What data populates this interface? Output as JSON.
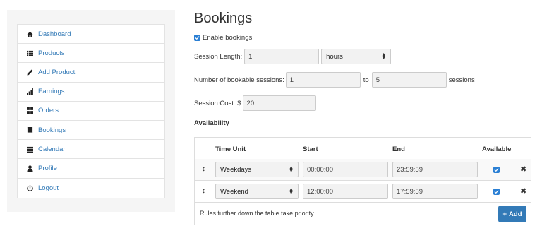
{
  "sidebar": {
    "items": [
      {
        "label": "Dashboard",
        "icon": "home-icon"
      },
      {
        "label": "Products",
        "icon": "list-icon"
      },
      {
        "label": "Add Product",
        "icon": "pencil-icon"
      },
      {
        "label": "Earnings",
        "icon": "signal-icon"
      },
      {
        "label": "Orders",
        "icon": "grid-icon"
      },
      {
        "label": "Bookings",
        "icon": "book-icon"
      },
      {
        "label": "Calendar",
        "icon": "calendar-icon"
      },
      {
        "label": "Profile",
        "icon": "user-icon"
      },
      {
        "label": "Logout",
        "icon": "power-icon"
      }
    ]
  },
  "page": {
    "title": "Bookings",
    "enable_label": "Enable bookings",
    "session_length_label": "Session Length:",
    "session_length_value": "1",
    "session_length_unit": "hours",
    "num_sessions_label": "Number of bookable sessions:",
    "num_sessions_from": "1",
    "to_label": "to",
    "num_sessions_to": "5",
    "sessions_label": "sessions",
    "session_cost_label": "Session Cost: $",
    "session_cost_value": "20",
    "availability_label": "Availability"
  },
  "table": {
    "headers": {
      "time_unit": "Time Unit",
      "start": "Start",
      "end": "End",
      "available": "Available"
    },
    "rows": [
      {
        "time_unit": "Weekdays",
        "start": "00:00:00",
        "end": "23:59:59",
        "available": true
      },
      {
        "time_unit": "Weekend",
        "start": "12:00:00",
        "end": "17:59:59",
        "available": true
      }
    ],
    "footer_note": "Rules further down the table take priority.",
    "add_label": "Add"
  },
  "colors": {
    "accent": "#337ab7",
    "checkbox": "#2a7fd4"
  }
}
